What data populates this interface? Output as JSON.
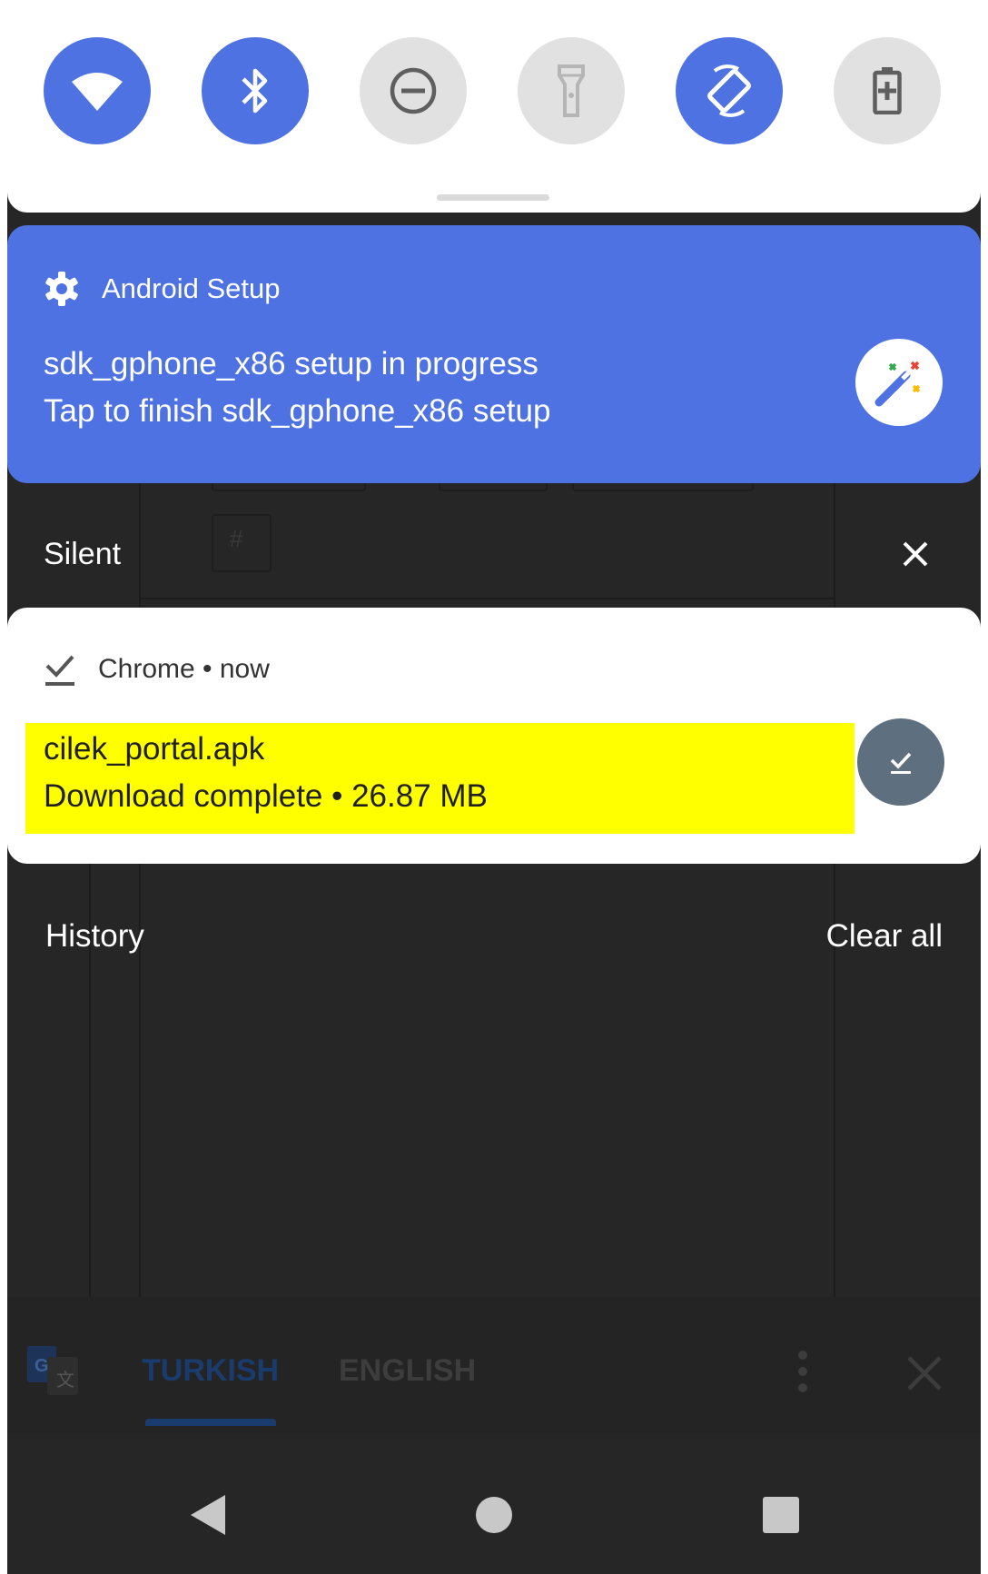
{
  "quick_settings": {
    "tiles": [
      {
        "name": "wifi-icon",
        "state": "on"
      },
      {
        "name": "bluetooth-icon",
        "state": "on"
      },
      {
        "name": "do-not-disturb-icon",
        "state": "off"
      },
      {
        "name": "flashlight-icon",
        "state": "off"
      },
      {
        "name": "auto-rotate-icon",
        "state": "on"
      },
      {
        "name": "battery-saver-icon",
        "state": "off"
      }
    ],
    "accent_color": "#4f72e3"
  },
  "setup_notification": {
    "app_name": "Android Setup",
    "title": "sdk_gphone_x86 setup in progress",
    "text": "Tap to finish sdk_gphone_x86 setup",
    "icon": "gear-icon",
    "action_icon": "magic-wand-icon"
  },
  "silent_section": {
    "label": "Silent",
    "close_icon": "close-icon"
  },
  "download_notification": {
    "app_name": "Chrome",
    "separator": "•",
    "time": "now",
    "header": "Chrome • now",
    "title": "cilek_portal.apk",
    "text": "Download complete • 26.87 MB",
    "icon": "download-done-icon",
    "highlight_color": "#ffff00"
  },
  "history_row": {
    "history_label": "History",
    "clear_all_label": "Clear all"
  },
  "background_app": {
    "hash": "#",
    "translate_bar": {
      "source_language": "TURKISH",
      "target_language": "ENGLISH"
    }
  },
  "navbar": {
    "back": "back-icon",
    "home": "home-icon",
    "recents": "recents-icon"
  }
}
